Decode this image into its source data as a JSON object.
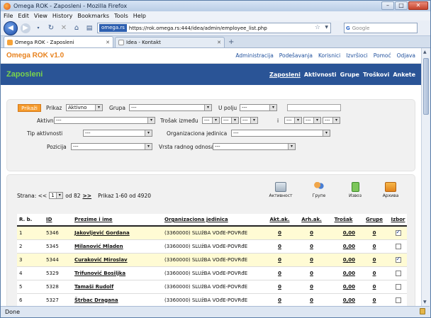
{
  "browser": {
    "window_title": "Omega ROK - Zaposleni - Mozilla Firefox",
    "menu": [
      "File",
      "Edit",
      "View",
      "History",
      "Bookmarks",
      "Tools",
      "Help"
    ],
    "site_identity": "omega.rs",
    "url": "https://rok.omega.rs:444/idea/admin/employee_list.php",
    "search_placeholder": "Google",
    "tabs": [
      {
        "label": "Omega ROK - Zaposleni",
        "active": true
      },
      {
        "label": "Idea - Kontakt",
        "active": false
      }
    ],
    "status": "Done"
  },
  "app": {
    "brand": "Omega ROK v1.0",
    "top_nav": [
      "Administracija",
      "Podešavanja",
      "Korisnici",
      "Izvršioci",
      "Pomoć",
      "Odjava"
    ],
    "section_title": "Zaposleni",
    "sub_nav": [
      "Zaposleni",
      "Aktivnosti",
      "Grupe",
      "Troškovi",
      "Ankete"
    ]
  },
  "filters": {
    "button": "Prikaži",
    "prikaz_label": "Prikaz",
    "prikaz_value": "Aktivno",
    "grupa_label": "Grupa",
    "grupa_value": "---",
    "u_polju_label": "U polju",
    "u_polju_value": "---",
    "aktivnost_label": "Aktivnost",
    "aktivnost_value": "---",
    "trosak_label": "Trošak između",
    "i_label": "i",
    "dash": "---",
    "tip_label": "Tip aktivnosti",
    "tip_value": "---",
    "org_label": "Organizaciona jedinica",
    "org_value": "---",
    "pozicija_label": "Pozicija",
    "pozicija_value": "---",
    "vrsta_label": "Vrsta radnog odnosa",
    "vrsta_value": "---"
  },
  "pager": {
    "strana": "Strana: <<",
    "page": "1",
    "od": "od 82",
    "next": ">>",
    "info": "Prikaz 1-60 od 4920"
  },
  "actions": [
    "Активност",
    "Групе",
    "Извоз",
    "Архива"
  ],
  "table": {
    "columns": [
      "R. b.",
      "ID",
      "Prezime i ime",
      "Organizaciona jedinica",
      "Akt.ak.",
      "Arh.ak.",
      "Trošak",
      "Grupe",
      "Izbor"
    ],
    "rows": [
      {
        "rb": "1",
        "id": "5346",
        "name": "Jakovljević Gordana",
        "org": "(3360000) SLUžBA VOđE-POVRđE",
        "akt": "0",
        "arh": "0",
        "trosak": "0,00",
        "grupe": "0",
        "izbor": true,
        "hl": true
      },
      {
        "rb": "2",
        "id": "5345",
        "name": "Milanović Mladen",
        "org": "(3360000) SLUžBA VOđE-POVRđE",
        "akt": "0",
        "arh": "0",
        "trosak": "0,00",
        "grupe": "0",
        "izbor": false,
        "hl": false
      },
      {
        "rb": "3",
        "id": "5344",
        "name": "Curaković Miroslav",
        "org": "(3360000) SLUžBA VOđE-POVRđE",
        "akt": "0",
        "arh": "0",
        "trosak": "0,00",
        "grupe": "0",
        "izbor": true,
        "hl": true
      },
      {
        "rb": "4",
        "id": "5329",
        "name": "Trifunović Bosiljka",
        "org": "(3360000) SLUžBA VOđE-POVRđE",
        "akt": "0",
        "arh": "0",
        "trosak": "0,00",
        "grupe": "0",
        "izbor": false,
        "hl": false
      },
      {
        "rb": "5",
        "id": "5328",
        "name": "Tamaši Rudolf",
        "org": "(3360000) SLUžBA VOđE-POVRđE",
        "akt": "0",
        "arh": "0",
        "trosak": "0,00",
        "grupe": "0",
        "izbor": false,
        "hl": false
      },
      {
        "rb": "6",
        "id": "5327",
        "name": "Štrbac Dragana",
        "org": "(3360000) SLUžBA VOđE-POVRđE",
        "akt": "0",
        "arh": "0",
        "trosak": "0,00",
        "grupe": "0",
        "izbor": false,
        "hl": false
      }
    ]
  }
}
